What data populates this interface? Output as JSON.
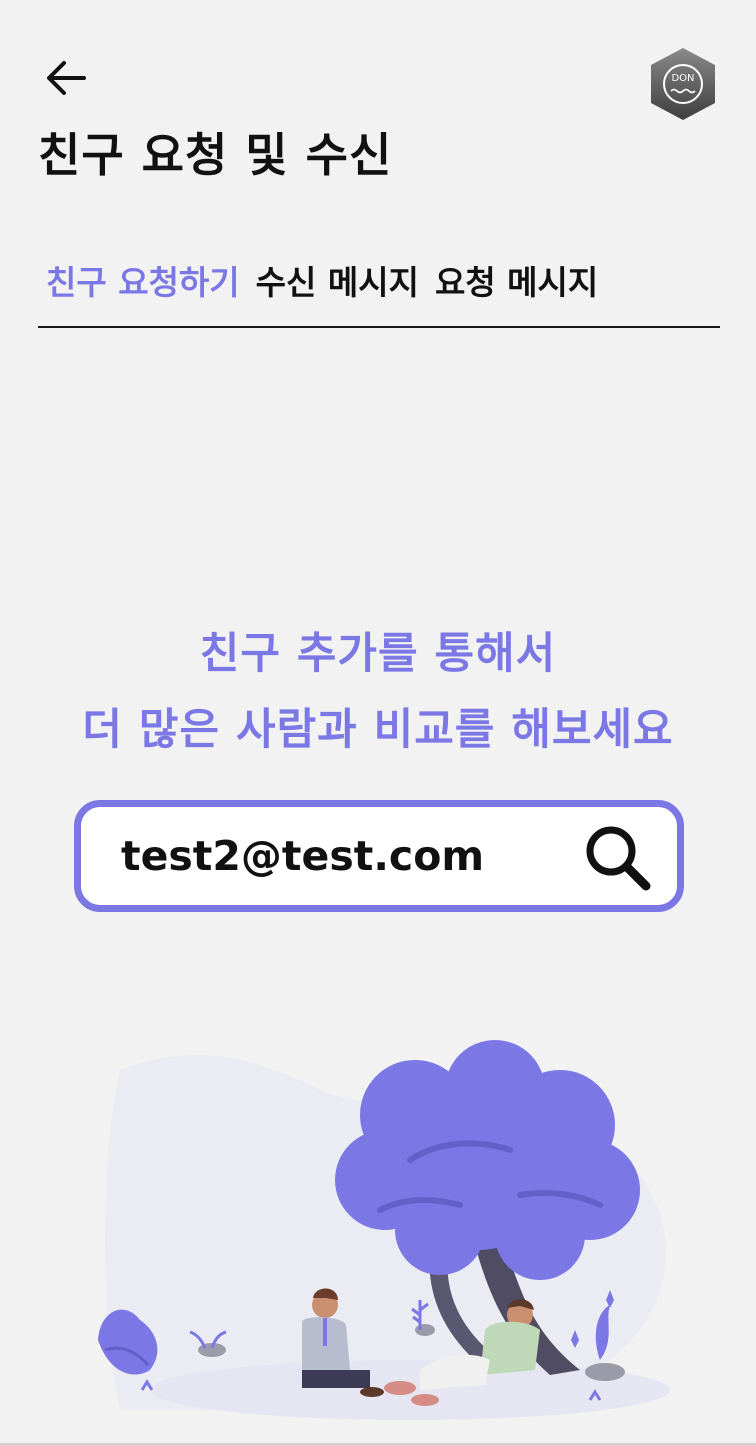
{
  "header": {
    "title": "친구 요청 및 수신",
    "avatar_label": "DON",
    "back_icon": "arrow-left-icon"
  },
  "tabs": [
    {
      "label": "친구 요청하기",
      "active": true
    },
    {
      "label": "수신 메시지",
      "active": false
    },
    {
      "label": "요청 메시지",
      "active": false
    }
  ],
  "promo": {
    "line1": "친구 추가를 통해서",
    "line2": "더 많은 사람과 비교를 해보세요"
  },
  "search": {
    "value": "test2@test.com",
    "icon": "search-icon"
  },
  "colors": {
    "accent": "#7b78e6",
    "background": "#f2f2f2",
    "text": "#111111"
  }
}
